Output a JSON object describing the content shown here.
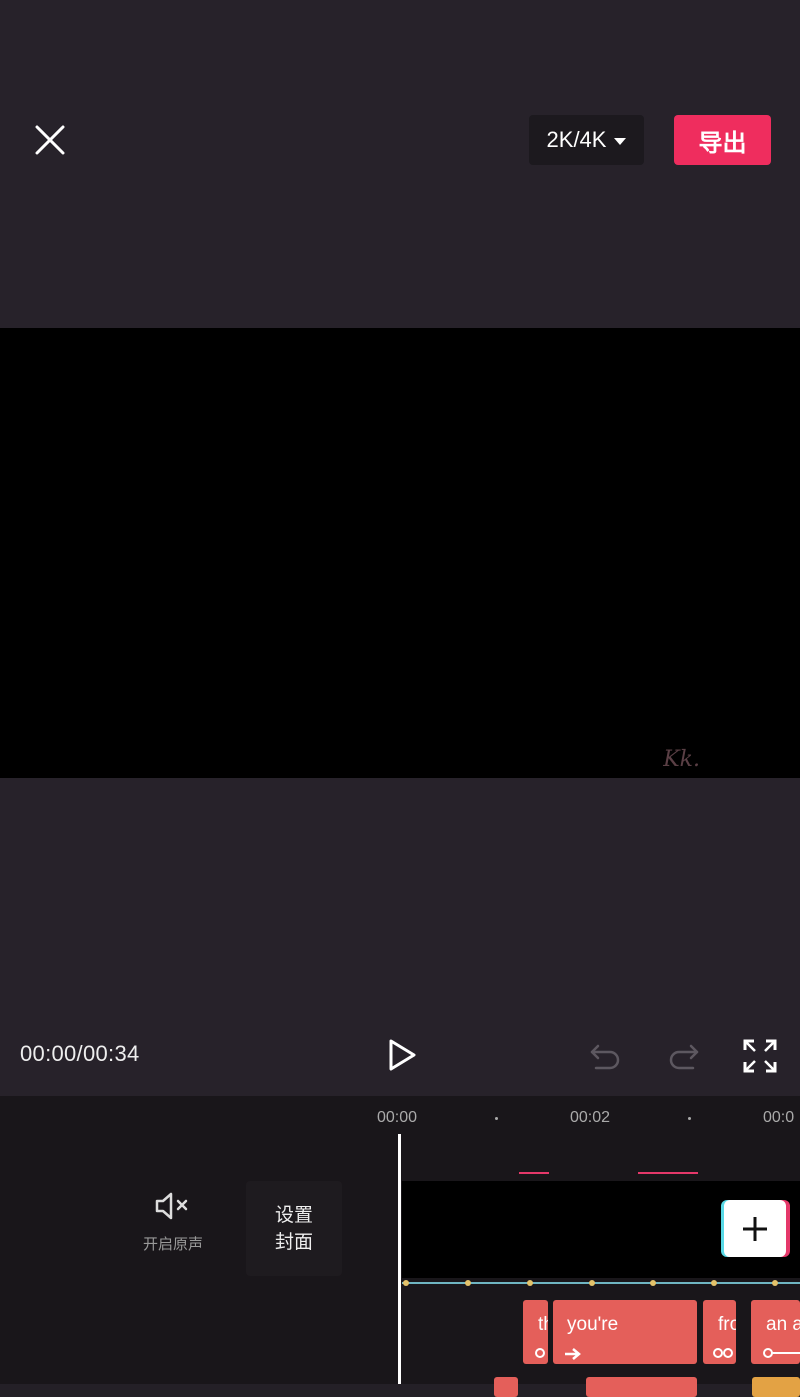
{
  "header": {
    "resolution_label": "2K/4K",
    "export_label": "导出"
  },
  "preview": {
    "watermark": "Kk."
  },
  "player": {
    "timecode": "00:00/00:34"
  },
  "timeline": {
    "ruler": [
      "00:00",
      "00:02",
      "00:0"
    ],
    "mute_label": "开启原声",
    "cover_line1": "设置",
    "cover_line2": "封面",
    "clips": [
      "th",
      "you're",
      "fro",
      "an a"
    ]
  },
  "colors": {
    "accent": "#ef2d5e",
    "clip": "#e45f5a",
    "audio_line": "#6fb5c2",
    "audio_keyframe": "#e3c26a"
  }
}
